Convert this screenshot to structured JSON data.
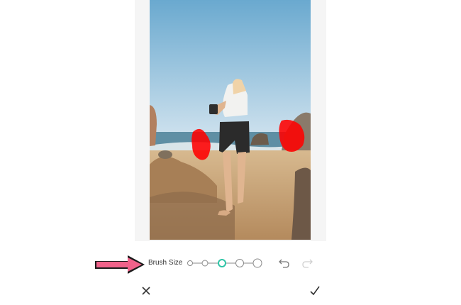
{
  "editor": {
    "tool": "brush",
    "brush_size_label": "Brush Size",
    "brush_sizes": 5,
    "brush_size_selected": 3
  },
  "icons": {
    "undo": "undo-icon",
    "redo": "redo-icon",
    "close": "close-icon",
    "confirm": "check-icon",
    "arrow": "pointer-arrow-icon"
  },
  "colors": {
    "accent": "#2ec4a6",
    "mask": "#ff0000",
    "arrow": "#f0628a"
  }
}
